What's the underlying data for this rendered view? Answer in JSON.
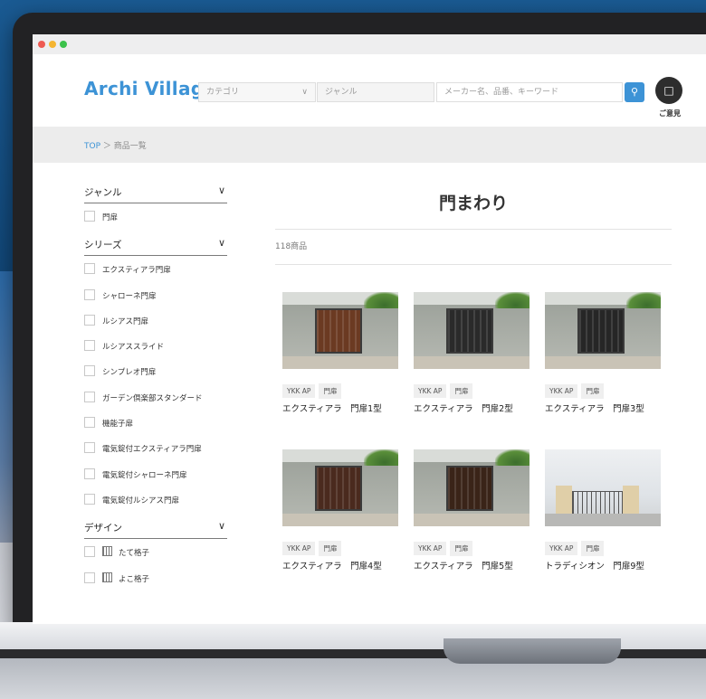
{
  "browser": {
    "title": ""
  },
  "header": {
    "logo": "Archi Village",
    "category_placeholder": "カテゴリ",
    "genre_placeholder": "ジャンル",
    "keyword_placeholder": "メーカー名、品番、キーワード",
    "opinion_label": "ご意見"
  },
  "breadcrumb": {
    "top": "TOP",
    "separator": "＞",
    "current": "商品一覧"
  },
  "sidebar": {
    "sections": [
      {
        "title": "ジャンル",
        "items": [
          "門扉"
        ]
      },
      {
        "title": "シリーズ",
        "items": [
          "エクスティアラ門扉",
          "シャローネ門扉",
          "ルシアス門扉",
          "ルシアススライド",
          "シンプレオ門扉",
          "ガーデン倶楽部スタンダード",
          "機能子扉",
          "電気錠付エクスティアラ門扉",
          "電気錠付シャローネ門扉",
          "電気錠付ルシアス門扉"
        ]
      },
      {
        "title": "デザイン",
        "items": [
          "たて格子",
          "よこ格子"
        ]
      }
    ]
  },
  "main": {
    "title": "門まわり",
    "count": "118商品",
    "products": [
      {
        "maker": "YKK AP",
        "genre": "門扉",
        "name": "エクスティアラ　門扉1型",
        "gate": "#6b3a22"
      },
      {
        "maker": "YKK AP",
        "genre": "門扉",
        "name": "エクスティアラ　門扉2型",
        "gate": "#2a2a2a"
      },
      {
        "maker": "YKK AP",
        "genre": "門扉",
        "name": "エクスティアラ　門扉3型",
        "gate": "#262626"
      },
      {
        "maker": "YKK AP",
        "genre": "門扉",
        "name": "エクスティアラ　門扉4型",
        "gate": "#4a2a1e"
      },
      {
        "maker": "YKK AP",
        "genre": "門扉",
        "name": "エクスティアラ　門扉5型",
        "gate": "#3a2418"
      },
      {
        "maker": "YKK AP",
        "genre": "門扉",
        "name": "トラディシオン　門扉9型",
        "gate": "#555555"
      }
    ]
  },
  "colors": {
    "accent": "#3d93d6"
  }
}
